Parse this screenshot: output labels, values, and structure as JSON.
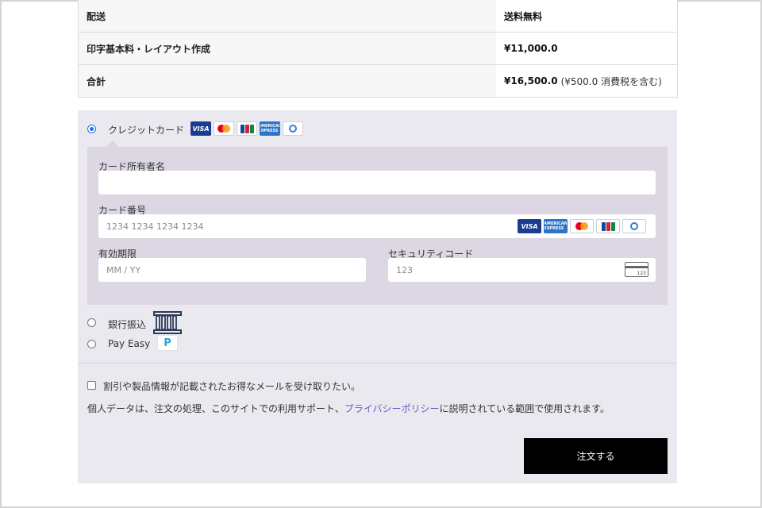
{
  "summary": {
    "rows": [
      {
        "label": "配送",
        "value": "送料無料"
      },
      {
        "label": "印字基本料・レイアウト作成",
        "value": "¥11,000.0"
      },
      {
        "label": "合計",
        "value": "¥16,500.0",
        "note": "(¥500.0 消費税を含む)"
      }
    ]
  },
  "payment": {
    "methods": {
      "credit": {
        "label": "クレジットカード",
        "selected": true
      },
      "bank": {
        "label": "銀行振込",
        "selected": false
      },
      "payeasy": {
        "label": "Pay Easy",
        "selected": false
      }
    },
    "card_brand_icons": [
      "visa-icon",
      "mastercard-icon",
      "jcb-icon",
      "amex-icon",
      "diners-icon"
    ],
    "card_brand_text": {
      "visa": "VISA",
      "amex": "AMERICAN EXPRESS"
    },
    "form": {
      "holder_label": "カード所有者名",
      "holder_value": "",
      "number_label": "カード番号",
      "number_placeholder": "1234 1234 1234 1234",
      "expiry_label": "有効期限",
      "expiry_placeholder": "MM / YY",
      "cvc_label": "セキュリティコード",
      "cvc_placeholder": "123",
      "cvc_icon_text": "123"
    },
    "payeasy_icon_text": "P"
  },
  "consent": {
    "newsletter_label": "割引や製品情報が記載されたお得なメールを受け取りたい。",
    "privacy_prefix": "個人データは、注文の処理、このサイトでの利用サポート、",
    "privacy_link": "プライバシーポリシー",
    "privacy_suffix": "に説明されている範囲で使用されます。"
  },
  "actions": {
    "order_label": "注文する"
  },
  "colors": {
    "accent_radio": "#1a73e8",
    "panel": "#ebe9f0",
    "cc_panel": "#dcd7e3",
    "button": "#000000",
    "link": "#5f5fc4"
  }
}
